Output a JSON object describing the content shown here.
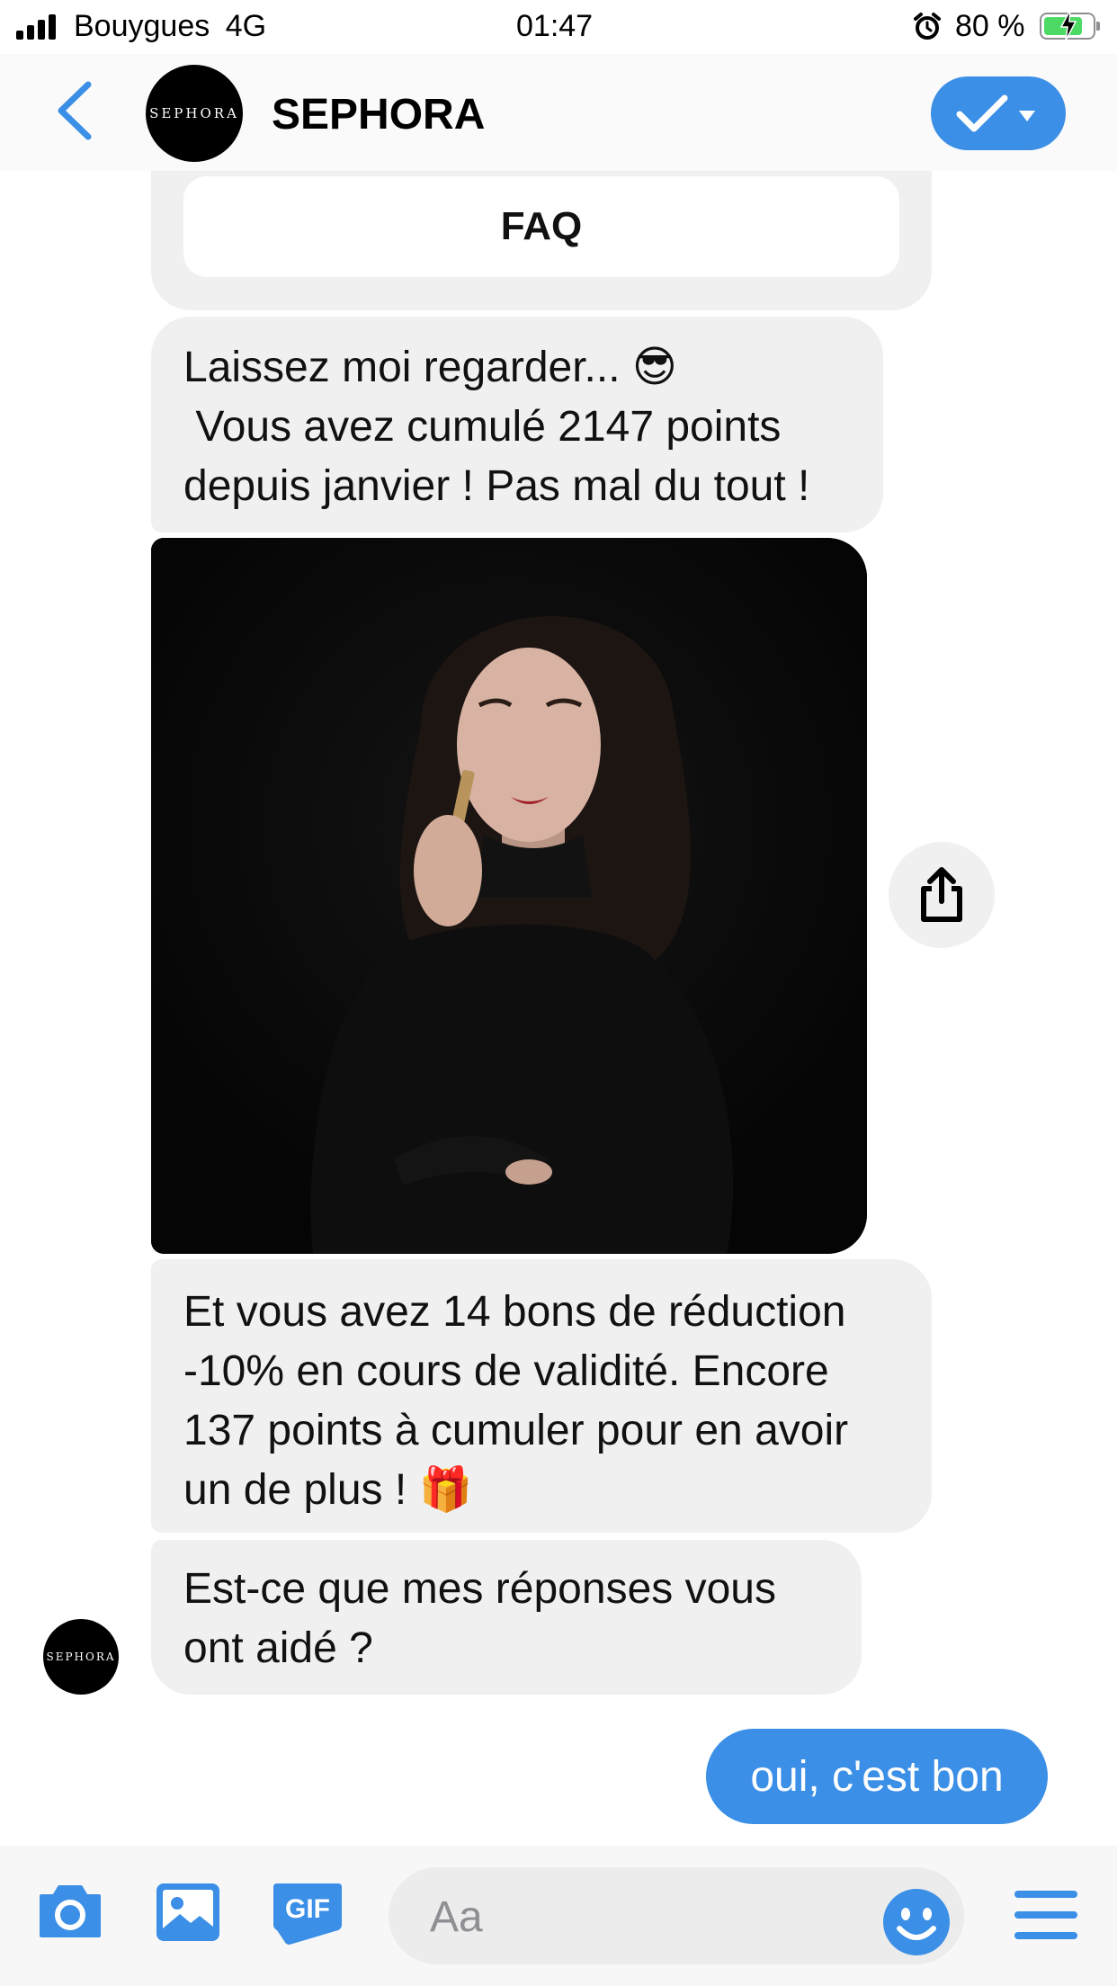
{
  "status_bar": {
    "carrier": "Bouygues",
    "network": "4G",
    "time": "01:47",
    "battery_percent": "80 %",
    "battery_level": 0.8,
    "icons": [
      "signal-icon",
      "alarm-icon",
      "battery-charging-icon"
    ]
  },
  "header": {
    "title": "SEPHORA",
    "avatar_text": "SEPHORA",
    "icons": [
      "back-chevron-icon",
      "check-icon",
      "caret-down-icon"
    ],
    "accent_color": "#3b8fe6"
  },
  "messages": {
    "faq_button": "FAQ",
    "m1": [
      "Laissez moi regarder... 😎",
      " Vous avez cumulé 2147 points",
      "depuis janvier ! Pas mal du tout !"
    ],
    "m2": [
      "Et vous avez 14 bons de réduction",
      "-10% en cours de validité. Encore",
      "137 points à cumuler pour en avoir",
      "un de plus ! 🎁"
    ],
    "m3": [
      "Est-ce que mes réponses vous",
      "ont aidé ?"
    ],
    "reply": "oui, c'est bon",
    "bot_avatar_text": "SEPHORA",
    "image_icon": "share-icon"
  },
  "composer": {
    "placeholder": "Aa",
    "gif_label": "GIF",
    "icons": [
      "camera-icon",
      "gallery-icon",
      "gif-icon",
      "emoji-icon",
      "menu-icon"
    ]
  },
  "colors": {
    "accent": "#3b8fe6",
    "bubble_gray": "#f0f0f0",
    "battery_green": "#4cd964"
  }
}
